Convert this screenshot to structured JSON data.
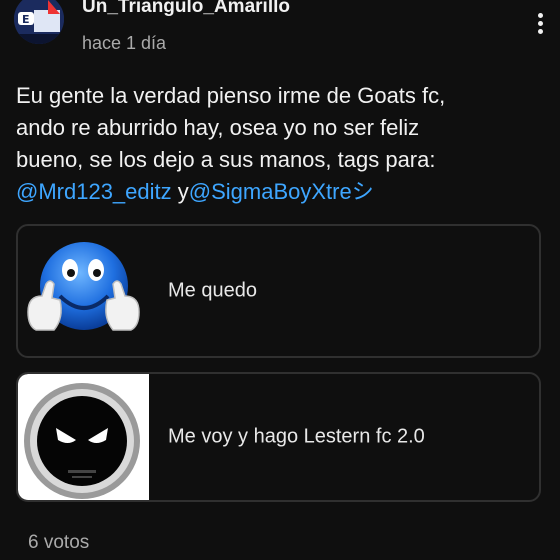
{
  "post": {
    "author": "Un_Triangulo_Amarillo",
    "time": "hace 1 día",
    "text_lines": [
      "Eu gente la verdad pienso irme de Goats fc,",
      "ando re aburrido hay, osea yo no ser feliz",
      "bueno, se los dejo a sus manos, tags para:"
    ],
    "mention1": "@Mrd123_editz",
    "connector": " y",
    "mention2": "@SigmaBoyXtreシ"
  },
  "poll": {
    "options": [
      {
        "label": "Me quedo",
        "image": "thumbs-up-blue-smiley"
      },
      {
        "label": "Me voy y hago Lestern fc 2.0",
        "image": "black-round-logo-white-eyes"
      }
    ],
    "votes": "6 votos"
  },
  "colors": {
    "background": "#0f0f0f",
    "mention": "#3ea6ff",
    "muted": "#aaaaaa"
  },
  "icons": {
    "menu": "more-vertical-icon"
  }
}
